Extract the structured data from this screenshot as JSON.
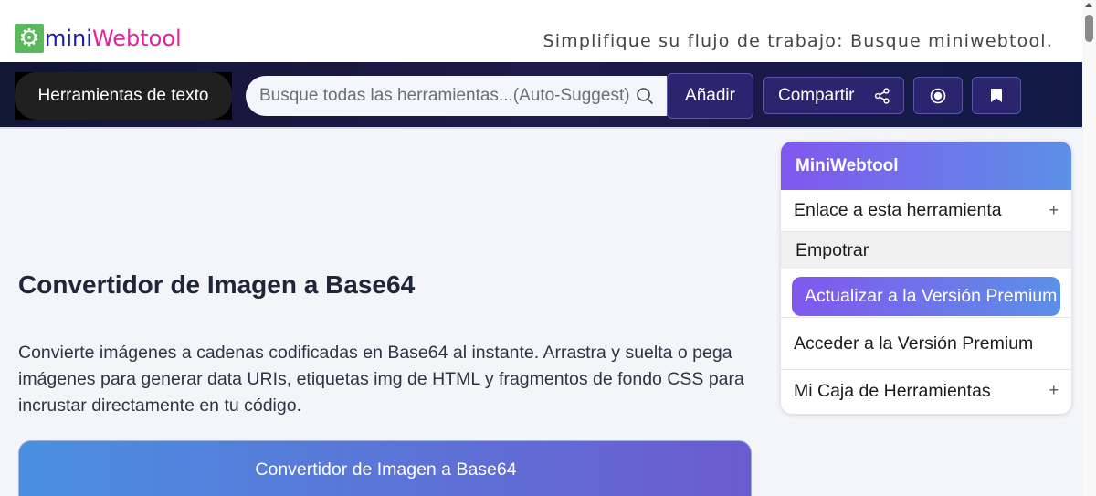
{
  "header": {
    "logo_mini": "mini",
    "logo_web": "Webtool",
    "tagline": "Simplifique su flujo de trabajo: Busque miniwebtool."
  },
  "navbar": {
    "category_label": "Herramientas de texto",
    "search_placeholder": "Busque todas las herramientas...(Auto-Suggest)",
    "add_label": "Añadir",
    "share_label": "Compartir"
  },
  "main": {
    "title": "Convertidor de Imagen a Base64",
    "description": "Convierte imágenes a cadenas codificadas en Base64 al instante. Arrastra y suelta o pega imágenes para generar data URIs, etiquetas img de HTML y fragmentos de fondo CSS para incrustar directamente en tu código.",
    "card_title": "Convertidor de Imagen a Base64"
  },
  "widget": {
    "title": "MiniWebtool",
    "link_label": "Enlace a esta herramienta",
    "embed_label": "Empotrar",
    "upgrade_label": "Actualizar a la Versión Premium",
    "access_label": "Acceder a la Versión Premium",
    "toolbox_label": "Mi Caja de Herramientas",
    "plus_symbol": "+"
  },
  "colors": {
    "logo_green": "#5cb85c",
    "logo_mini": "#1c1ca8",
    "logo_web": "#e0259a",
    "navbar": "#1f1a4a",
    "accent_purple": "#8157ee",
    "accent_blue": "#5b90e6"
  }
}
